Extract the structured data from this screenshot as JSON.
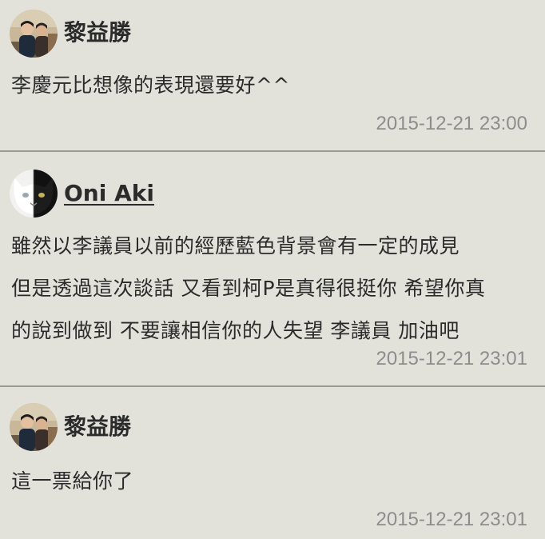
{
  "comments": [
    {
      "author": "黎益勝",
      "avatar_icon": "person-photo-icon",
      "body_lines": [
        "李慶元比想像的表現還要好^^"
      ],
      "timestamp": "2015-12-21 23:00"
    },
    {
      "author": "Oni Aki",
      "avatar_icon": "cat-photo-icon",
      "body_lines": [
        "雖然以李議員以前的經歷藍色背景會有一定的成見",
        "但是透過這次談話 又看到柯P是真得很挺你 希望你真",
        "的說到做到 不要讓相信你的人失望 李議員 加油吧"
      ],
      "timestamp": "2015-12-21 23:01"
    },
    {
      "author": "黎益勝",
      "avatar_icon": "person-photo-icon",
      "body_lines": [
        "這一票給你了"
      ],
      "timestamp": "2015-12-21 23:01"
    }
  ],
  "colors": {
    "background": "#e2e2da",
    "divider": "#9a9a94",
    "text": "#2b2b2b",
    "timestamp": "#8d8d8d"
  }
}
